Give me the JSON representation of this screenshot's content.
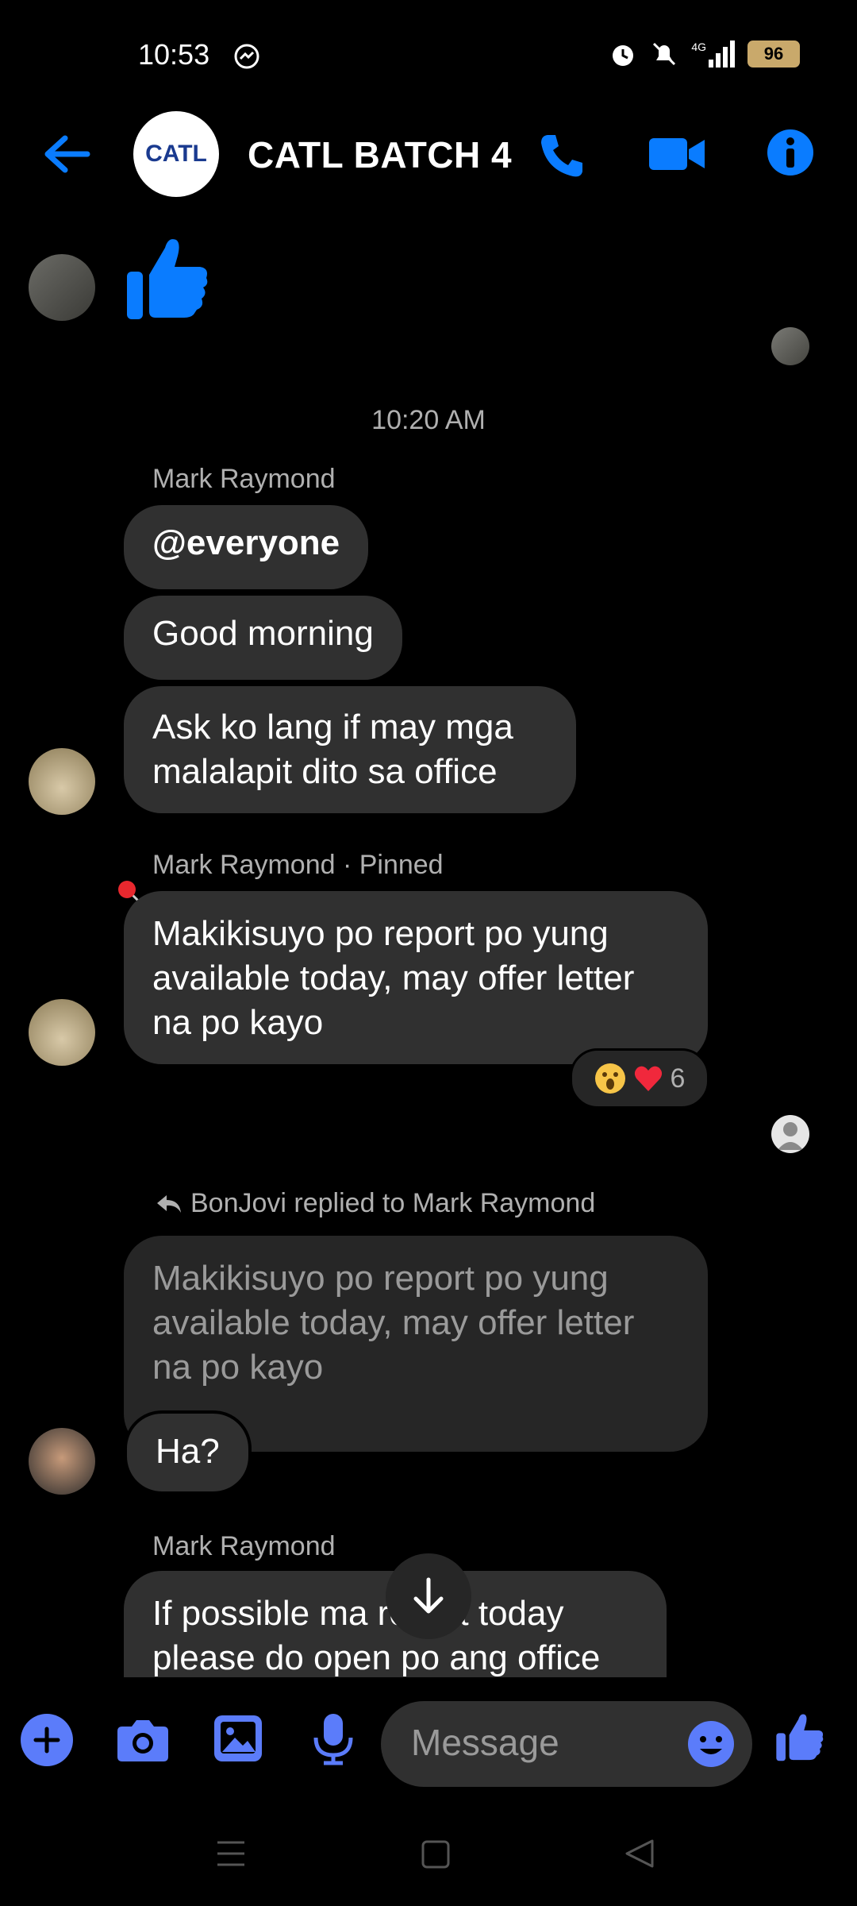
{
  "status": {
    "time": "10:53",
    "network": "4G",
    "battery": "96"
  },
  "header": {
    "group_name": "CATL BATCH 4",
    "logo_text": "CATL"
  },
  "thread": {
    "timestamp": "10:20 AM",
    "msg1": {
      "sender": "Mark Raymond",
      "texts": [
        "@everyone",
        "Good morning",
        "Ask ko lang if may mga malalapit dito sa office"
      ]
    },
    "msg2": {
      "sender": "Mark Raymond · Pinned",
      "text": "Makikisuyo po report po yung available today, may offer letter na po kayo",
      "reaction_count": "6"
    },
    "reply": {
      "label": "BonJovi replied to Mark Raymond",
      "quoted": "Makikisuyo po report po yung available today, may offer letter na po kayo",
      "text": "Ha?"
    },
    "msg3": {
      "sender": "Mark Raymond",
      "text": "If possible ma report today please do open po ang office"
    }
  },
  "composer": {
    "placeholder": "Message"
  },
  "colors": {
    "accent": "#0a7cff",
    "composer_icon": "#5b7cfa",
    "bubble": "#303030"
  }
}
